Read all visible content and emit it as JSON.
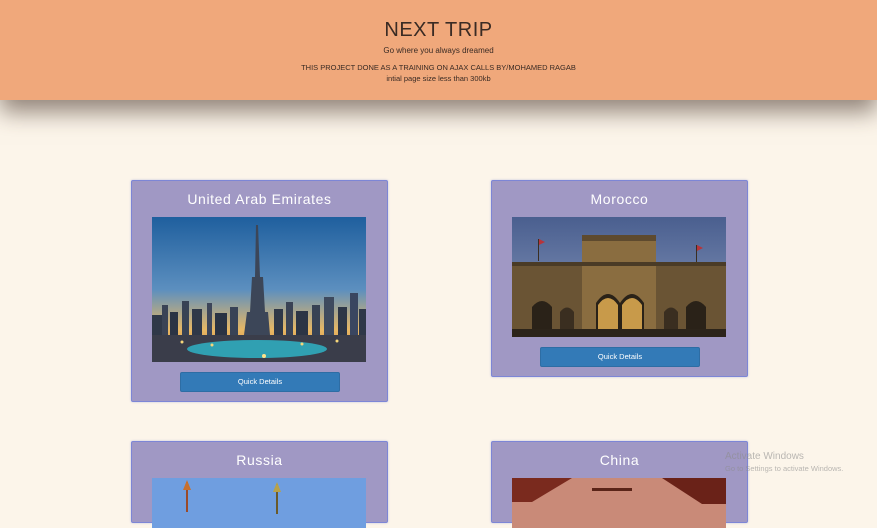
{
  "header": {
    "title": "NEXT TRIP",
    "tagline": "Go where you always dreamed",
    "note_line1": "THIS PROJECT DONE AS A TRAINING ON AJAX CALLS BY/MOHAMED RAGAB",
    "note_line2": "intial page size less than 300kb"
  },
  "countries": [
    {
      "name": "United Arab Emirates",
      "button": "Quick Details"
    },
    {
      "name": "Morocco",
      "button": "Quick Details"
    },
    {
      "name": "Russia"
    },
    {
      "name": "China"
    }
  ],
  "watermark": {
    "line1": "Activate Windows",
    "line2": "Go to Settings to activate Windows."
  },
  "colors": {
    "header_bg": "#f0a87b",
    "page_bg": "#fcf5ea",
    "card_bg": "#a098c4",
    "card_border": "#7d86d6",
    "button_bg": "#337ab7"
  }
}
